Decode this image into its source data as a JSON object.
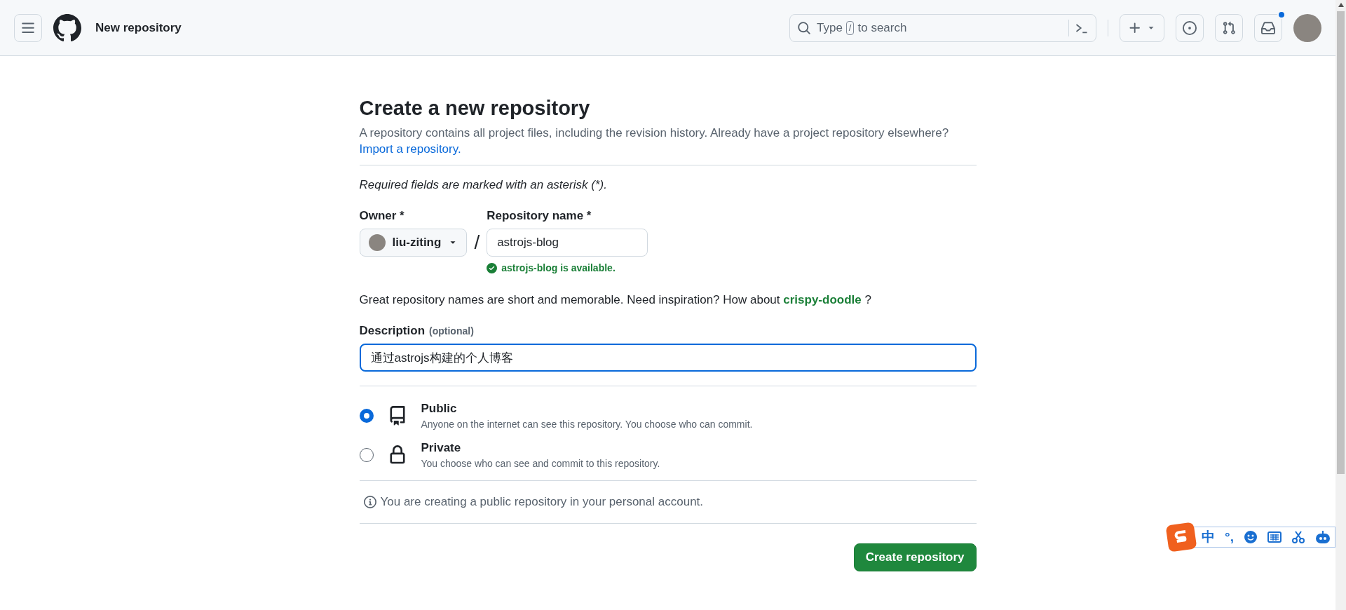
{
  "header": {
    "title": "New repository",
    "search": {
      "placeholder_before": "Type",
      "key": "/",
      "placeholder_after": "to search"
    },
    "inbox_unread": true
  },
  "page": {
    "title": "Create a new repository",
    "intro": "A repository contains all project files, including the revision history. Already have a project repository elsewhere?",
    "import_link": "Import a repository.",
    "required_note": "Required fields are marked with an asterisk (*).",
    "owner": {
      "label": "Owner *",
      "value": "liu-ziting"
    },
    "separator": "/",
    "repo_name": {
      "label": "Repository name *",
      "value": "astrojs-blog",
      "status": "astrojs-blog is available."
    },
    "suggestion": {
      "text": "Great repository names are short and memorable. Need inspiration? How about",
      "name": "crispy-doodle",
      "end": "?"
    },
    "description": {
      "label": "Description",
      "hint": "(optional)",
      "value": "通过astrojs构建的个人博客",
      "focused": true
    },
    "visibility": [
      {
        "kind": "public",
        "title": "Public",
        "text": "Anyone on the internet can see this repository. You choose who can commit.",
        "selected": true
      },
      {
        "kind": "private",
        "title": "Private",
        "text": "You choose who can see and commit to this repository.",
        "selected": false
      }
    ],
    "notice": "You are creating a public repository in your personal account.",
    "submit": "Create repository"
  },
  "ime": {
    "mode": "中",
    "punctuation": "°,"
  }
}
